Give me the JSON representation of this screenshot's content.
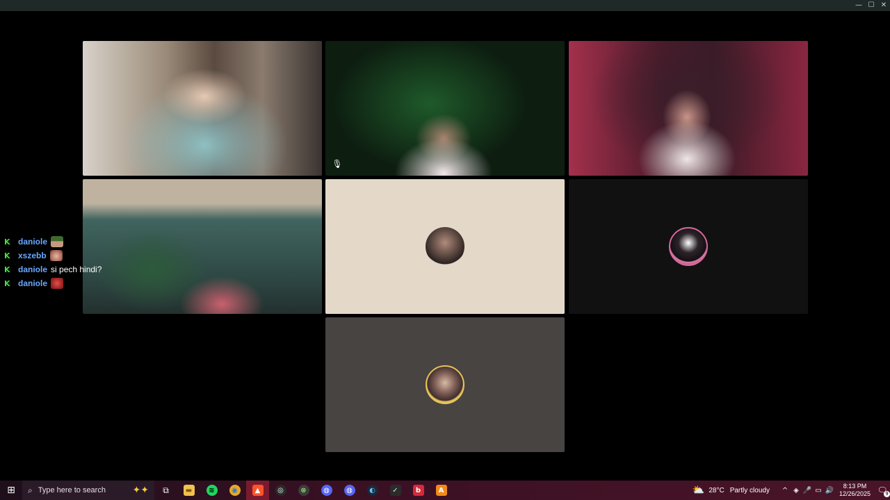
{
  "window_controls": {
    "minimize": "—",
    "maximize": "☐",
    "close": "✕"
  },
  "call": {
    "tiles": [
      {
        "kind": "video",
        "muted": false
      },
      {
        "kind": "video",
        "muted": true,
        "mute_glyph": "🎙"
      },
      {
        "kind": "video",
        "muted": false
      },
      {
        "kind": "video",
        "muted": false
      },
      {
        "kind": "avatar",
        "background": "#e4d9c9"
      },
      {
        "kind": "avatar",
        "background": "#111111"
      },
      {
        "kind": "avatar",
        "background": "#484441"
      }
    ]
  },
  "chat": {
    "badge_glyph": "K",
    "messages": [
      {
        "user": "daniole",
        "text": "",
        "emote": "green-hat-emote"
      },
      {
        "user": "xszebb",
        "text": "",
        "emote": "face-emote"
      },
      {
        "user": "daniole",
        "text": "si pech hindi?",
        "emote": ""
      },
      {
        "user": "daniole",
        "text": "",
        "emote": "red-face-emote"
      }
    ],
    "colors": {
      "badge": "#3be63b",
      "username": "#6aa7ff"
    }
  },
  "taskbar": {
    "start_glyph": "⊞",
    "search": {
      "placeholder": "Type here to search",
      "icon": "search-icon"
    },
    "apps": [
      {
        "name": "task-view",
        "glyph": "⧉"
      },
      {
        "name": "file-explorer",
        "glyph": "▬"
      },
      {
        "name": "spotify",
        "glyph": "≋"
      },
      {
        "name": "chrome",
        "glyph": "◉"
      },
      {
        "name": "brave",
        "glyph": "▲"
      },
      {
        "name": "obs",
        "glyph": "◎"
      },
      {
        "name": "xbox",
        "glyph": "⊗"
      },
      {
        "name": "discord-canary",
        "glyph": "◍"
      },
      {
        "name": "discord",
        "glyph": "◍"
      },
      {
        "name": "steam",
        "glyph": "◐"
      },
      {
        "name": "vscode-like",
        "glyph": "✓"
      },
      {
        "name": "app-red",
        "glyph": "b"
      },
      {
        "name": "app-orange",
        "glyph": "A"
      }
    ],
    "weather": {
      "temp": "28°C",
      "condition": "Partly cloudy",
      "icon": "partly-cloudy-icon"
    },
    "tray": {
      "chevron": "^",
      "network": "◈",
      "mic": "🎤",
      "display": "▭",
      "volume": "🔊"
    },
    "clock": {
      "time": "8:13 PM",
      "date": "12/26/2025"
    },
    "notifications": {
      "glyph": "🗨",
      "count": "9"
    }
  }
}
